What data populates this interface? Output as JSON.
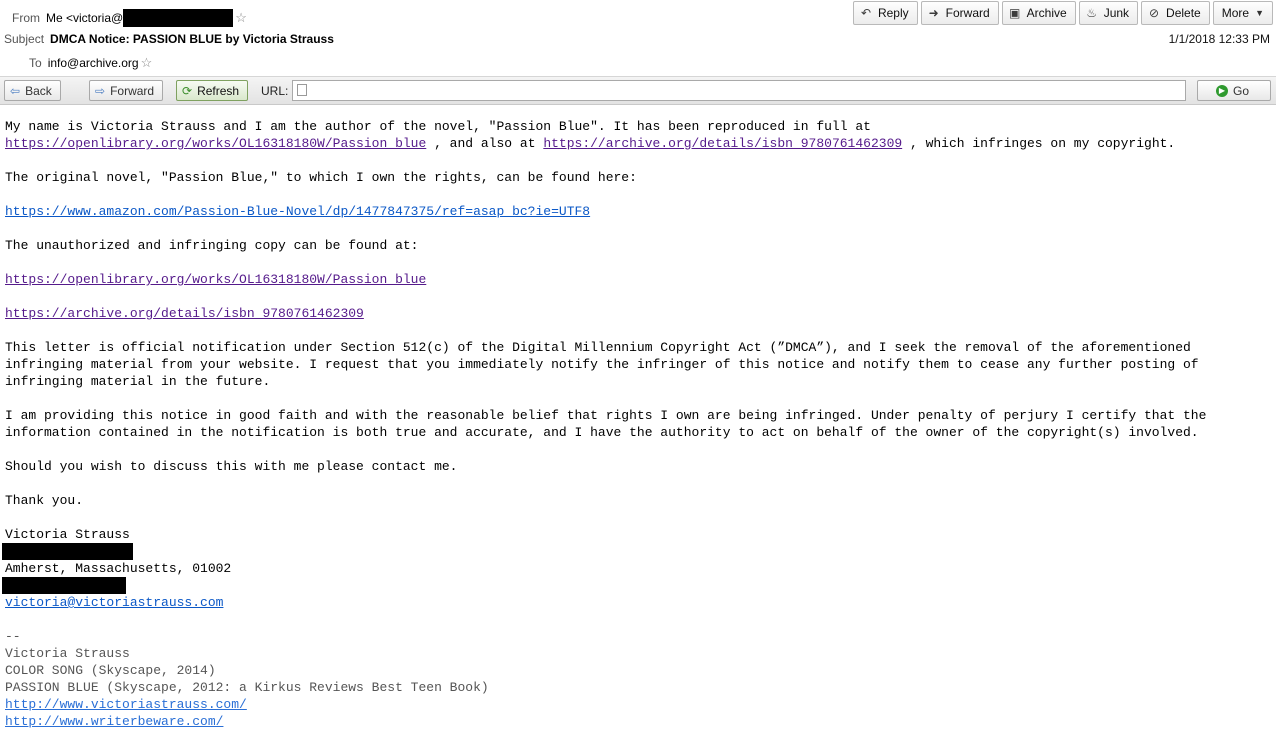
{
  "header": {
    "from_label": "From",
    "from_value": "Me <victoria@",
    "subject_label": "Subject",
    "subject_value": "DMCA Notice: PASSION BLUE by Victoria Strauss",
    "to_label": "To",
    "to_value": "info@archive.org",
    "date": "1/1/2018 12:33 PM",
    "actions": {
      "reply": "Reply",
      "forward": "Forward",
      "archive": "Archive",
      "junk": "Junk",
      "delete": "Delete",
      "more": "More"
    }
  },
  "toolbar": {
    "back": "Back",
    "forward": "Forward",
    "refresh": "Refresh",
    "url_label": "URL:",
    "url_value": "",
    "go": "Go"
  },
  "body": {
    "p1_a": "My name is Victoria Strauss and I am the author of the novel, \"Passion Blue\". It has been reproduced in full at ",
    "p1_link1": "https://openlibrary.org/works/OL16318180W/Passion_blue",
    "p1_b": " , and also at ",
    "p1_link2": "https://archive.org/details/isbn_9780761462309",
    "p1_c": " , which infringes on my copyright.",
    "p2": "The original novel, \"Passion Blue,\" to which I own the rights, can be found here:",
    "amazon_link": "https://www.amazon.com/Passion-Blue-Novel/dp/1477847375/ref=asap_bc?ie=UTF8",
    "p3": "The unauthorized and infringing copy can be found at:",
    "infringing_link1": "https://openlibrary.org/works/OL16318180W/Passion_blue",
    "infringing_link2": "https://archive.org/details/isbn_9780761462309",
    "p4": "This letter is official notification under Section 512(c) of the Digital Millennium Copyright Act (”DMCA”), and I seek the removal of the aforementioned infringing material from your website. I request that you immediately notify the infringer of this notice and notify them to cease any further posting of infringing material in the future.",
    "p5": "I am providing this notice in good faith and with the reasonable belief that rights I own are being infringed. Under penalty of perjury I certify that the information contained in the notification is both true and accurate, and I have the authority to act on behalf of the owner of the copyright(s) involved.",
    "p6": "Should you wish to discuss this with me please contact me.",
    "p7": "Thank you.",
    "sign_name": "Victoria Strauss",
    "sign_city": "Amherst, Massachusetts, 01002",
    "sign_email": "victoria@victoriastrauss.com"
  },
  "signature": {
    "sep": "--",
    "name": "Victoria Strauss",
    "book1": "COLOR SONG (Skyscape, 2014)",
    "book2": "PASSION BLUE (Skyscape, 2012: a Kirkus Reviews Best Teen Book)",
    "link1": "http://www.victoriastrauss.com/",
    "link2": "http://www.writerbeware.com/"
  }
}
